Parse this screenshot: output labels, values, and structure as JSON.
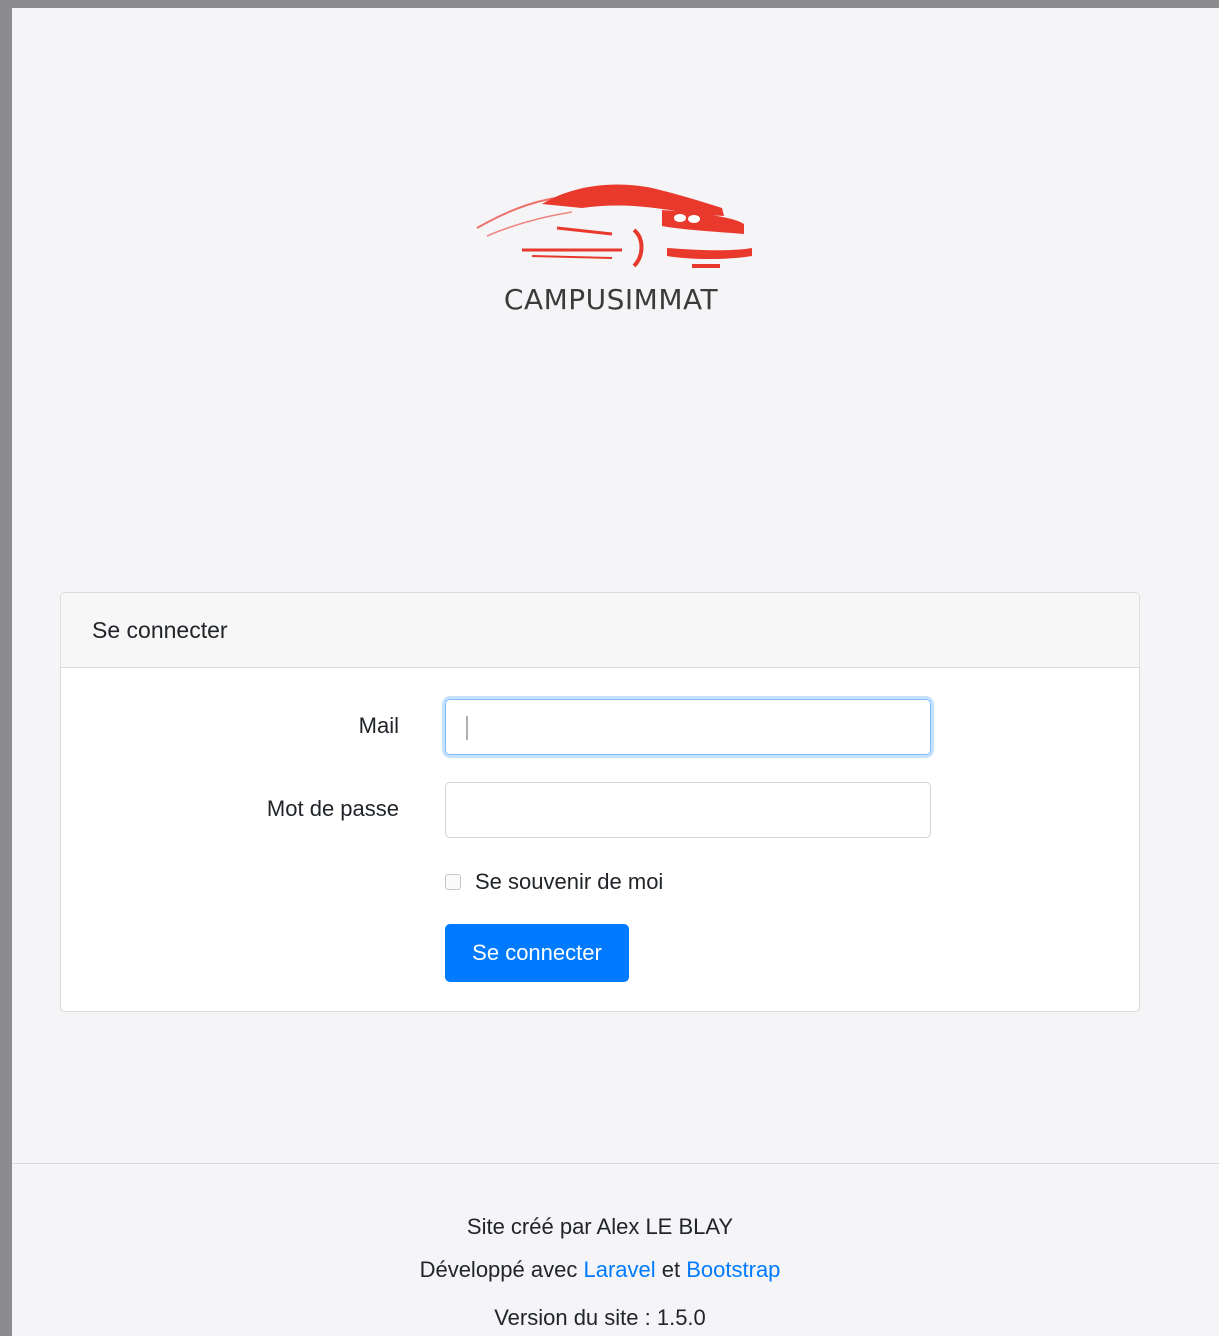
{
  "brand": {
    "name": "CAMPUSIMMAT",
    "logo_color": "#e8392c"
  },
  "login_card": {
    "title": "Se connecter",
    "mail_label": "Mail",
    "mail_value": "",
    "password_label": "Mot de passe",
    "password_value": "",
    "remember_label": "Se souvenir de moi",
    "remember_checked": false,
    "submit_label": "Se connecter"
  },
  "footer": {
    "created_by": "Site créé par Alex LE BLAY",
    "developed_prefix": "Développé avec",
    "framework_link": "Laravel",
    "conjunction": "et",
    "css_link": "Bootstrap",
    "version": "Version du site : 1.5.0"
  },
  "colors": {
    "primary": "#007bff",
    "background": "#f5f5f8"
  }
}
